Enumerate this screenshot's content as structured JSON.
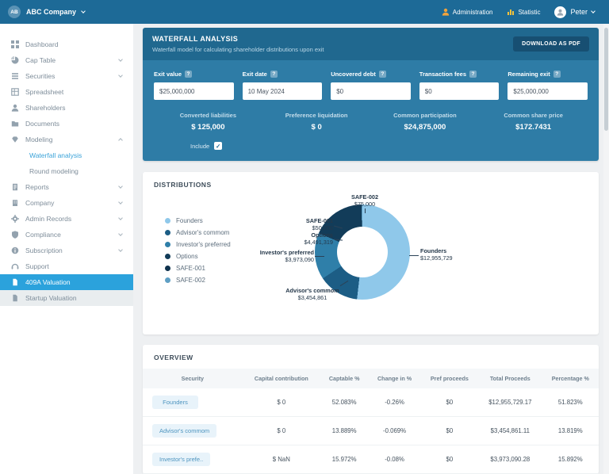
{
  "colors": {
    "topbar": "#1d6a97",
    "panel": "#2e7ca6",
    "panel_header": "#20688f",
    "accent": "#2ba2dc",
    "chart": [
      "#8fc8ea",
      "#1c5d85",
      "#2f7fa9",
      "#123c59",
      "#0e324d",
      "#5f9fc4"
    ]
  },
  "topbar": {
    "company_initials": "AB",
    "company_name": "ABC Company",
    "administration_label": "Administration",
    "statistic_label": "Statistic",
    "user_name": "Peter"
  },
  "sidebar": {
    "items": [
      {
        "label": "Dashboard",
        "icon": "dashboard"
      },
      {
        "label": "Cap Table",
        "icon": "pie",
        "chevron": "down"
      },
      {
        "label": "Securities",
        "icon": "list",
        "chevron": "down"
      },
      {
        "label": "Spreadsheet",
        "icon": "table"
      },
      {
        "label": "Shareholders",
        "icon": "user"
      },
      {
        "label": "Documents",
        "icon": "folder"
      },
      {
        "label": "Modeling",
        "icon": "gem",
        "chevron": "up"
      },
      {
        "label": "Waterfall analysis",
        "variant": "sub active-link"
      },
      {
        "label": "Round modeling",
        "variant": "sub"
      },
      {
        "label": "Reports",
        "icon": "report",
        "chevron": "down"
      },
      {
        "label": "Company",
        "icon": "building",
        "chevron": "down"
      },
      {
        "label": "Admin Records",
        "icon": "gear",
        "chevron": "down"
      },
      {
        "label": "Compliance",
        "icon": "shield",
        "chevron": "down"
      },
      {
        "label": "Subscription",
        "icon": "info",
        "chevron": "down"
      },
      {
        "label": "Support",
        "icon": "headset"
      },
      {
        "label": "409A Valuation",
        "icon": "doc",
        "variant": "active"
      },
      {
        "label": "Startup Valuation",
        "icon": "doc",
        "variant": "muted"
      }
    ]
  },
  "waterfall": {
    "title": "WATERFALL ANALYSIS",
    "subtitle": "Waterfall model for calculating shareholder distributions upon exit",
    "download_label": "DOWNLOAD AS PDF",
    "fields": [
      {
        "label": "Exit value",
        "value": "$25,000,000"
      },
      {
        "label": "Exit date",
        "value": "10 May 2024"
      },
      {
        "label": "Uncovered debt",
        "value": "$0"
      },
      {
        "label": "Transaction fees",
        "value": "$0"
      },
      {
        "label": "Remaining exit",
        "value": "$25,000,000"
      }
    ],
    "stats": [
      {
        "label": "Converted liabilities",
        "value": "$ 125,000"
      },
      {
        "label": "Preference liquidation",
        "value": "$ 0"
      },
      {
        "label": "Common participation",
        "value": "$24,875,000"
      },
      {
        "label": "Common share price",
        "value": "$172.7431"
      }
    ],
    "include_label": "Include",
    "include_checked": true
  },
  "chart_data": {
    "type": "pie",
    "donut": true,
    "title": "DISTRIBUTIONS",
    "legend_position": "left",
    "labels": [
      "Founders",
      "Advisor's commom",
      "Investor's preferred",
      "Options",
      "SAFE-001",
      "SAFE-002"
    ],
    "values": [
      12955729,
      3454861,
      3973090,
      4491319,
      50000,
      75000
    ],
    "display_values": [
      "$12,955,729",
      "$3,454,861",
      "$3,973,090",
      "$4,491,319",
      "$50,000",
      "$75,000"
    ]
  },
  "distributions": {
    "title": "DISTRIBUTIONS",
    "callouts": [
      {
        "name": "SAFE-002",
        "value": "$75,000"
      },
      {
        "name": "SAFE-001",
        "value": "$50,000"
      },
      {
        "name": "Options",
        "value": "$4,491,319"
      },
      {
        "name": "Investor's preferred",
        "value": "$3,973,090"
      },
      {
        "name": "Advisor's commom",
        "value": "$3,454,861"
      },
      {
        "name": "Founders",
        "value": "$12,955,729"
      }
    ]
  },
  "overview": {
    "title": "OVERVIEW",
    "columns": [
      "Security",
      "Capital contribution",
      "Captable %",
      "Change in %",
      "Pref proceeds",
      "Total Proceeds",
      "Percentage %"
    ],
    "rows": [
      [
        "Founders",
        "$ 0",
        "52.083%",
        "-0.26%",
        "$0",
        "$12,955,729.17",
        "51.823%"
      ],
      [
        "Advisor's commom",
        "$ 0",
        "13.889%",
        "-0.069%",
        "$0",
        "$3,454,861.11",
        "13.819%"
      ],
      [
        "Investor's prefe..",
        "$ NaN",
        "15.972%",
        "-0.08%",
        "$0",
        "$3,973,090.28",
        "15.892%"
      ]
    ]
  }
}
